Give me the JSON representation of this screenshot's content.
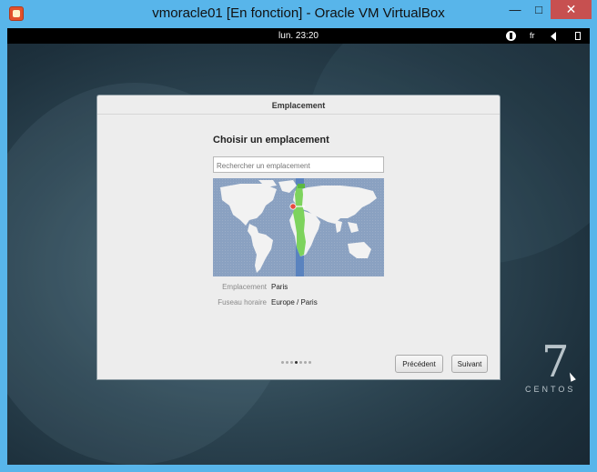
{
  "window": {
    "title": "vmoracle01 [En fonction] - Oracle VM VirtualBox",
    "minimize": "—",
    "maximize": "□",
    "close": "✕"
  },
  "topbar": {
    "clock": "lun. 23:20",
    "language": "fr",
    "icons": [
      "accessibility-icon",
      "volume-icon",
      "battery-icon"
    ]
  },
  "dialog": {
    "title": "Emplacement",
    "heading": "Choisir un emplacement",
    "search_placeholder": "Rechercher un emplacement",
    "location_label": "Emplacement",
    "location_value": "Paris",
    "timezone_label": "Fuseau horaire",
    "timezone_value": "Europe / Paris",
    "page_indicator": {
      "total": 7,
      "current": 4
    },
    "prev_button": "Précédent",
    "next_button": "Suivant"
  },
  "branding": {
    "seven": "7",
    "name": "CENTOS"
  },
  "colors": {
    "close_button": "#c75050",
    "frame": "#58b5ea",
    "timezone_highlight": "#7dd35d"
  }
}
